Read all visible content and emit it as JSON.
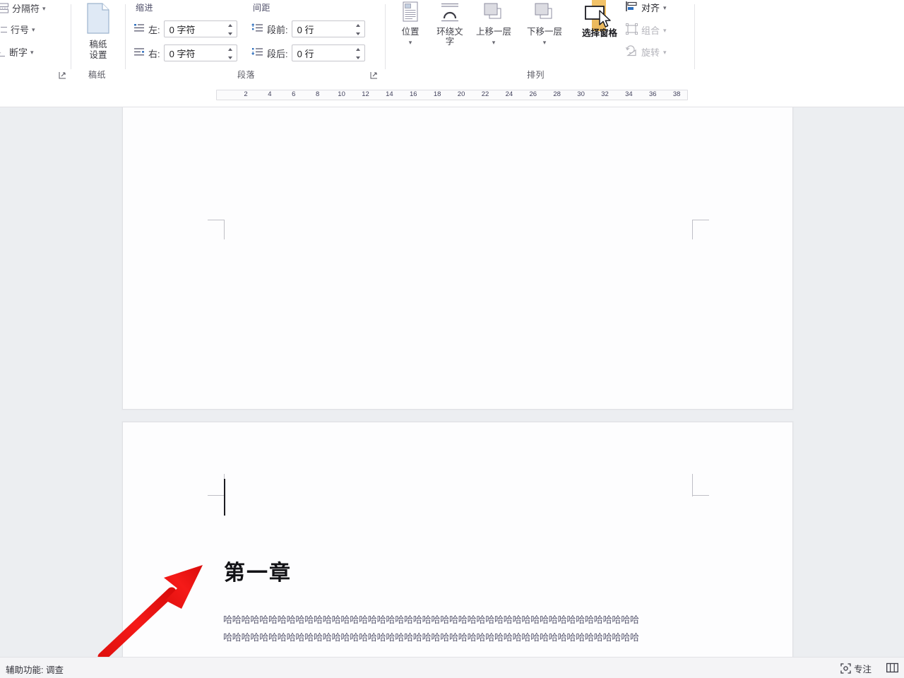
{
  "app": {
    "background": "#eceef1",
    "page_color": "#fdfdfe",
    "accent_highlight": "#eab75a",
    "annotation_color": "#e8110f"
  },
  "ribbon": {
    "page_setup_group": {
      "label": "稿纸",
      "mini_buttons": [
        {
          "name": "breaks",
          "label": "分隔符",
          "icon": "breaks-icon",
          "has_chevron": true
        },
        {
          "name": "line-numbers",
          "label": "行号",
          "icon": "line-numbers-icon",
          "has_chevron": true
        },
        {
          "name": "hyphenation",
          "label": "断字",
          "icon": "hyphenation-icon",
          "has_chevron": true
        }
      ],
      "launcher": "dialog-launcher-icon",
      "grid_paper_button": {
        "line1": "稿纸",
        "line2": "设置",
        "icon": "page-icon"
      }
    },
    "paragraph_group": {
      "label": "段落",
      "launcher": "dialog-launcher-icon",
      "subheads": {
        "indent": "缩进",
        "spacing": "间距"
      },
      "fields": [
        {
          "name": "indent-left",
          "icon": "indent-left-icon",
          "label": "左:",
          "value": "0 字符"
        },
        {
          "name": "indent-right",
          "icon": "indent-right-icon",
          "label": "右:",
          "value": "0 字符"
        },
        {
          "name": "spacing-before",
          "icon": "spacing-before-icon",
          "label": "段前:",
          "value": "0 行"
        },
        {
          "name": "spacing-after",
          "icon": "spacing-after-icon",
          "label": "段后:",
          "value": "0 行"
        }
      ]
    },
    "arrange_group": {
      "label": "排列",
      "buttons": [
        {
          "name": "position",
          "label": "位置",
          "icon": "position-icon",
          "dropdown": true,
          "selected": false
        },
        {
          "name": "wrap-text",
          "label": "环绕文字",
          "icon": "wrap-text-icon",
          "dropdown": true,
          "selected": false
        },
        {
          "name": "bring-forward",
          "label": "上移一层",
          "icon": "bring-forward-icon",
          "dropdown": true,
          "selected": false
        },
        {
          "name": "send-backward",
          "label": "下移一层",
          "icon": "send-backward-icon",
          "dropdown": true,
          "selected": false
        },
        {
          "name": "selection-pane",
          "label": "选择窗格",
          "icon": "selection-pane-icon",
          "dropdown": false,
          "selected": true
        }
      ],
      "side_buttons": [
        {
          "name": "align",
          "label": "对齐",
          "icon": "align-icon",
          "chevron": true,
          "enabled": true
        },
        {
          "name": "group",
          "label": "组合",
          "icon": "group-icon",
          "chevron": true,
          "enabled": false
        },
        {
          "name": "rotate",
          "label": "旋转",
          "icon": "rotate-icon",
          "chevron": true,
          "enabled": false
        }
      ]
    }
  },
  "ruler": {
    "ticks": [
      2,
      4,
      6,
      8,
      10,
      12,
      14,
      16,
      18,
      20,
      22,
      24,
      26,
      28,
      30,
      32,
      34,
      36,
      38
    ],
    "markers": [
      "first-line-indent-marker",
      "hanging-indent-marker",
      "right-indent-marker"
    ]
  },
  "document": {
    "pages": [
      {
        "name": "page-1",
        "content": ""
      },
      {
        "name": "page-2",
        "heading": "第一章",
        "body_lines": [
          "哈哈哈哈哈哈哈哈哈哈哈哈哈哈哈哈哈哈哈哈哈哈哈哈哈哈哈哈哈哈哈哈哈哈哈哈哈哈哈哈哈哈哈哈哈哈",
          "哈哈哈哈哈哈哈哈哈哈哈哈哈哈哈哈哈哈哈哈哈哈哈哈哈哈哈哈哈哈哈哈哈哈哈哈哈哈哈哈哈哈哈哈哈哈"
        ]
      }
    ]
  },
  "status_bar": {
    "accessibility": "辅助功能: 调查",
    "focus": "专注",
    "focus_icon": "focus-icon",
    "view_icon": "read-mode-icon"
  }
}
